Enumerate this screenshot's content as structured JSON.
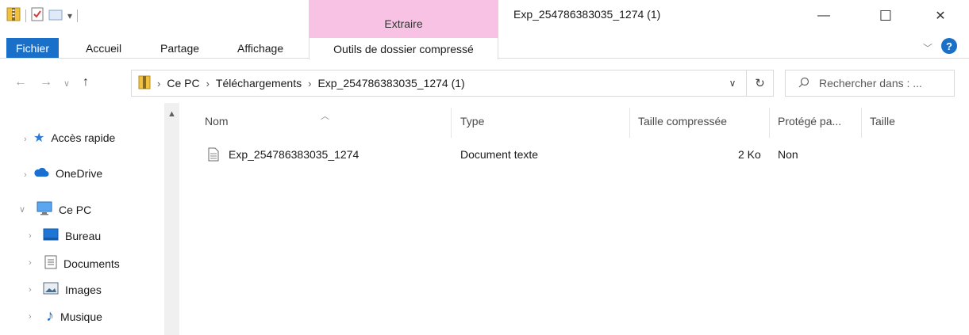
{
  "window": {
    "title": "Exp_254786383035_1274 (1)",
    "context_tab": "Extraire",
    "minimize_glyph": "—",
    "maximize_glyph": "☐",
    "close_glyph": "✕"
  },
  "ribbon": {
    "tabs": [
      "Fichier",
      "Accueil",
      "Partage",
      "Affichage",
      "Outils de dossier compressé"
    ],
    "active_tab": "Outils de dossier compressé",
    "file_color": "#1a6fc9",
    "context_color": "#f7c2e4"
  },
  "address": {
    "breadcrumbs": [
      "Ce PC",
      "Téléchargements",
      "Exp_254786383035_1274 (1)"
    ],
    "search_placeholder": "Rechercher dans : ..."
  },
  "nav": {
    "items": [
      {
        "label": "Accès rapide",
        "icon": "star-icon"
      },
      {
        "label": "OneDrive",
        "icon": "cloud-icon"
      },
      {
        "label": "Ce PC",
        "icon": "computer-icon"
      },
      {
        "label": "Bureau",
        "icon": "desktop-icon"
      },
      {
        "label": "Documents",
        "icon": "documents-icon"
      },
      {
        "label": "Images",
        "icon": "images-icon"
      },
      {
        "label": "Musique",
        "icon": "music-icon"
      }
    ]
  },
  "list": {
    "columns": [
      "Nom",
      "Type",
      "Taille compressée",
      "Protégé pa...",
      "Taille"
    ],
    "rows": [
      {
        "name": "Exp_254786383035_1274",
        "type": "Document texte",
        "compressed_size": "2 Ko",
        "protected": "Non",
        "size": ""
      }
    ]
  }
}
